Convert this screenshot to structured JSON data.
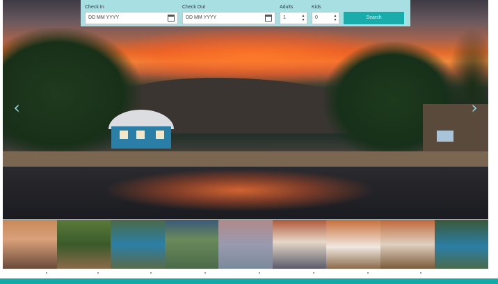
{
  "search": {
    "check_in_label": "Check In",
    "check_in_placeholder": "DD MM YYYY",
    "check_out_label": "Check Out",
    "check_out_placeholder": "DD MM YYYY",
    "adults_label": "Adults",
    "adults_value": "1",
    "kids_label": "Kids",
    "kids_value": "0",
    "search_button": "Search"
  },
  "carousel": {
    "prev_icon": "chevron-left-icon",
    "next_icon": "chevron-right-icon",
    "prev_glyph": "‹",
    "next_glyph": "›"
  },
  "thumbnails": [
    "patio-thumbnail",
    "deck-thumbnail",
    "yurt-exterior-thumbnail",
    "garden-thumbnail",
    "lake-view-thumbnail",
    "bedroom-thumbnail",
    "bedroom-2-thumbnail",
    "living-room-thumbnail",
    "yurt-exterior-2-thumbnail"
  ],
  "colors": {
    "accent": "#1aabab",
    "search_bar": "#a8dfe3",
    "footer": "#15aaa8"
  }
}
